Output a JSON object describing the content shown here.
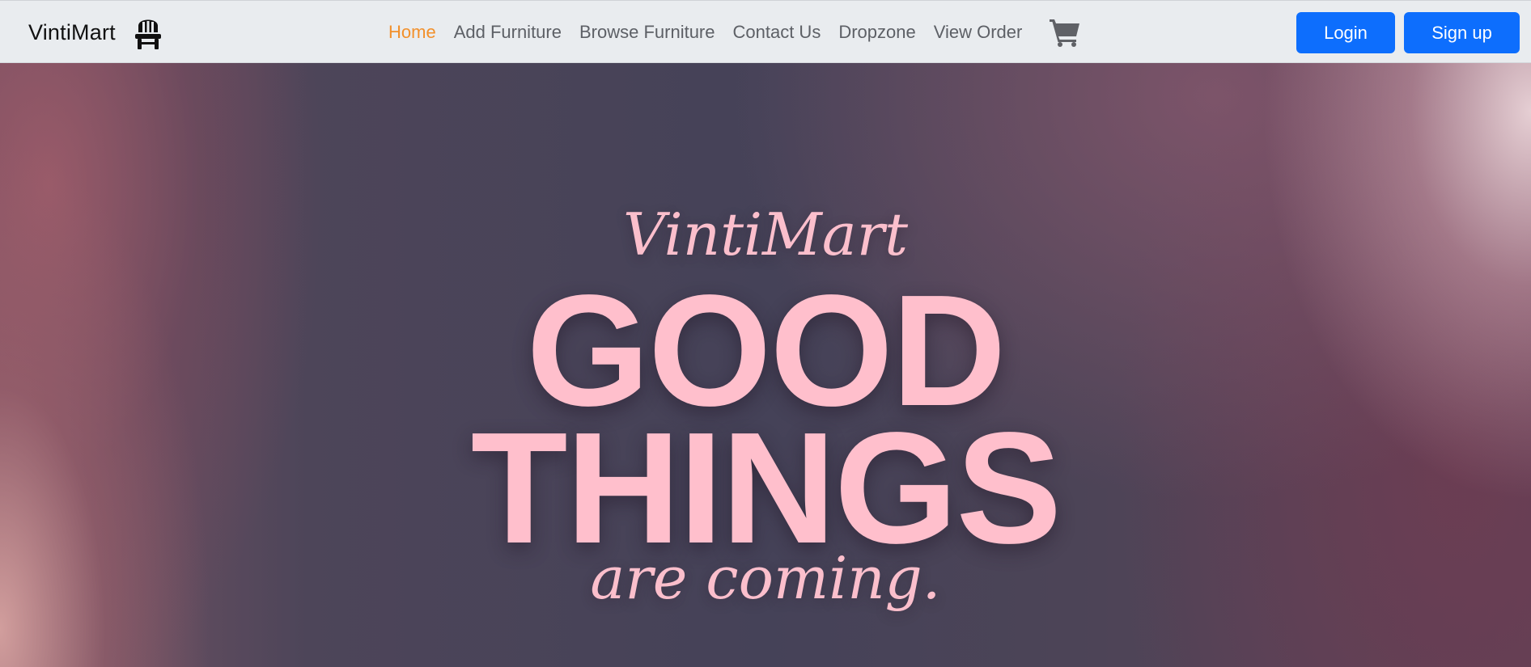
{
  "navbar": {
    "brand": {
      "name": "VintiMart",
      "icon": "chair-icon"
    },
    "links": [
      {
        "label": "Home",
        "active": true
      },
      {
        "label": "Add Furniture",
        "active": false
      },
      {
        "label": "Browse Furniture",
        "active": false
      },
      {
        "label": "Contact Us",
        "active": false
      },
      {
        "label": "Dropzone",
        "active": false
      },
      {
        "label": "View Order",
        "active": false
      }
    ],
    "cart_icon": "cart-icon",
    "login_label": "Login",
    "signup_label": "Sign up"
  },
  "hero": {
    "script_top": "VintiMart",
    "headline_line1": "GOOD",
    "headline_line2": "THINGS",
    "script_bottom": "are coming."
  },
  "colors": {
    "navbar_bg": "#e9ecef",
    "active_link": "#f2902b",
    "link": "#5d6066",
    "button": "#0d6efd",
    "hero_text": "#ffbfcc"
  }
}
